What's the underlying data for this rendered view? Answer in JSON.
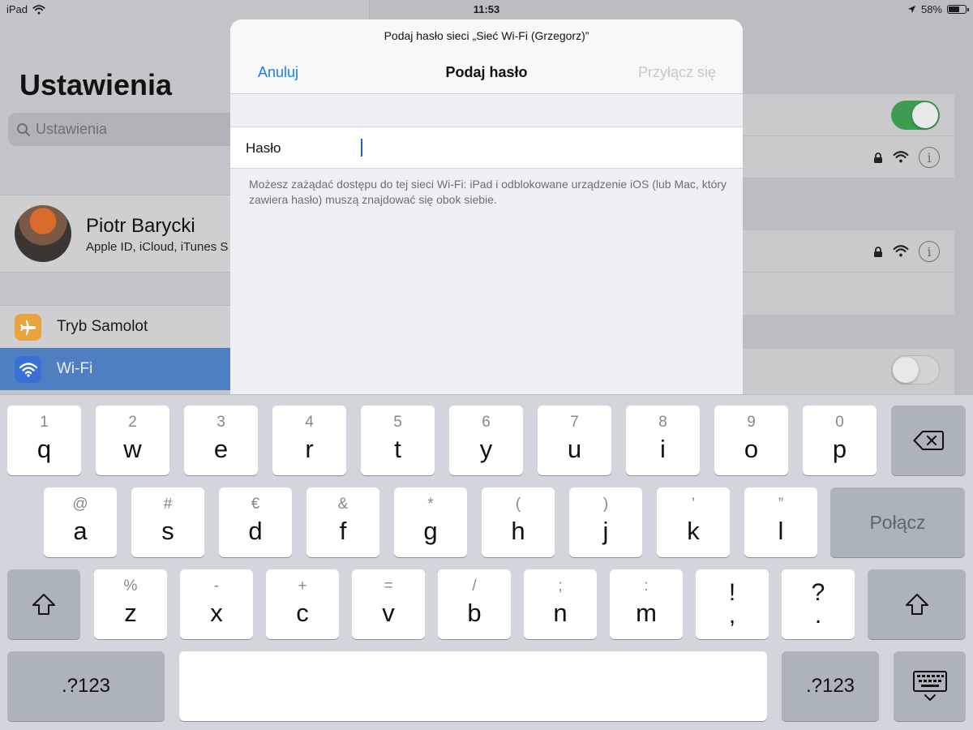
{
  "status_bar": {
    "device": "iPad",
    "time": "11:53",
    "battery": "58%"
  },
  "settings": {
    "title": "Ustawienia",
    "search_placeholder": "Ustawienia",
    "profile": {
      "name": "Piotr Barycki",
      "subtitle": "Apple ID, iCloud, iTunes S"
    },
    "items": [
      {
        "label": "Tryb Samolot"
      },
      {
        "label": "Wi-Fi"
      }
    ]
  },
  "modal": {
    "prompt": "Podaj hasło sieci „Sieć Wi-Fi (Grzegorz)”",
    "cancel": "Anuluj",
    "title": "Podaj hasło",
    "join": "Przyłącz się",
    "password_label": "Hasło",
    "password_value": "",
    "note": "Możesz zażądać dostępu do tej sieci Wi-Fi: iPad i odblokowane urządzenie iOS (lub Mac, który zawiera hasło) muszą znajdować się obok siebie."
  },
  "keyboard": {
    "row1": [
      {
        "alt": "1",
        "main": "q"
      },
      {
        "alt": "2",
        "main": "w"
      },
      {
        "alt": "3",
        "main": "e"
      },
      {
        "alt": "4",
        "main": "r"
      },
      {
        "alt": "5",
        "main": "t"
      },
      {
        "alt": "6",
        "main": "y"
      },
      {
        "alt": "7",
        "main": "u"
      },
      {
        "alt": "8",
        "main": "i"
      },
      {
        "alt": "9",
        "main": "o"
      },
      {
        "alt": "0",
        "main": "p"
      }
    ],
    "row2": [
      {
        "alt": "@",
        "main": "a"
      },
      {
        "alt": "#",
        "main": "s"
      },
      {
        "alt": "€",
        "main": "d"
      },
      {
        "alt": "&",
        "main": "f"
      },
      {
        "alt": "*",
        "main": "g"
      },
      {
        "alt": "(",
        "main": "h"
      },
      {
        "alt": ")",
        "main": "j"
      },
      {
        "alt": "’",
        "main": "k"
      },
      {
        "alt": "”",
        "main": "l"
      }
    ],
    "row3": [
      {
        "alt": "%",
        "main": "z"
      },
      {
        "alt": "-",
        "main": "x"
      },
      {
        "alt": "+",
        "main": "c"
      },
      {
        "alt": "=",
        "main": "v"
      },
      {
        "alt": "/",
        "main": "b"
      },
      {
        "alt": ";",
        "main": "n"
      },
      {
        "alt": ":",
        "main": "m"
      },
      {
        "top": "!",
        "bottom": ","
      },
      {
        "top": "?",
        "bottom": "."
      }
    ],
    "join_label": "Połącz",
    "numbers_label": ".?123"
  },
  "icons": {
    "backspace": "backspace-icon",
    "shift": "shift-icon",
    "hide_keyboard": "keyboard-hide-icon",
    "airplane": "airplane-icon",
    "wifi": "wifi-icon"
  },
  "colors": {
    "accent_blue": "#147efb",
    "disabled_gray": "#c7c7cc",
    "toggle_on_green": "#4cd964",
    "selected_row_blue": "#4f7fc1",
    "airplane_orange": "#e8a33d"
  }
}
